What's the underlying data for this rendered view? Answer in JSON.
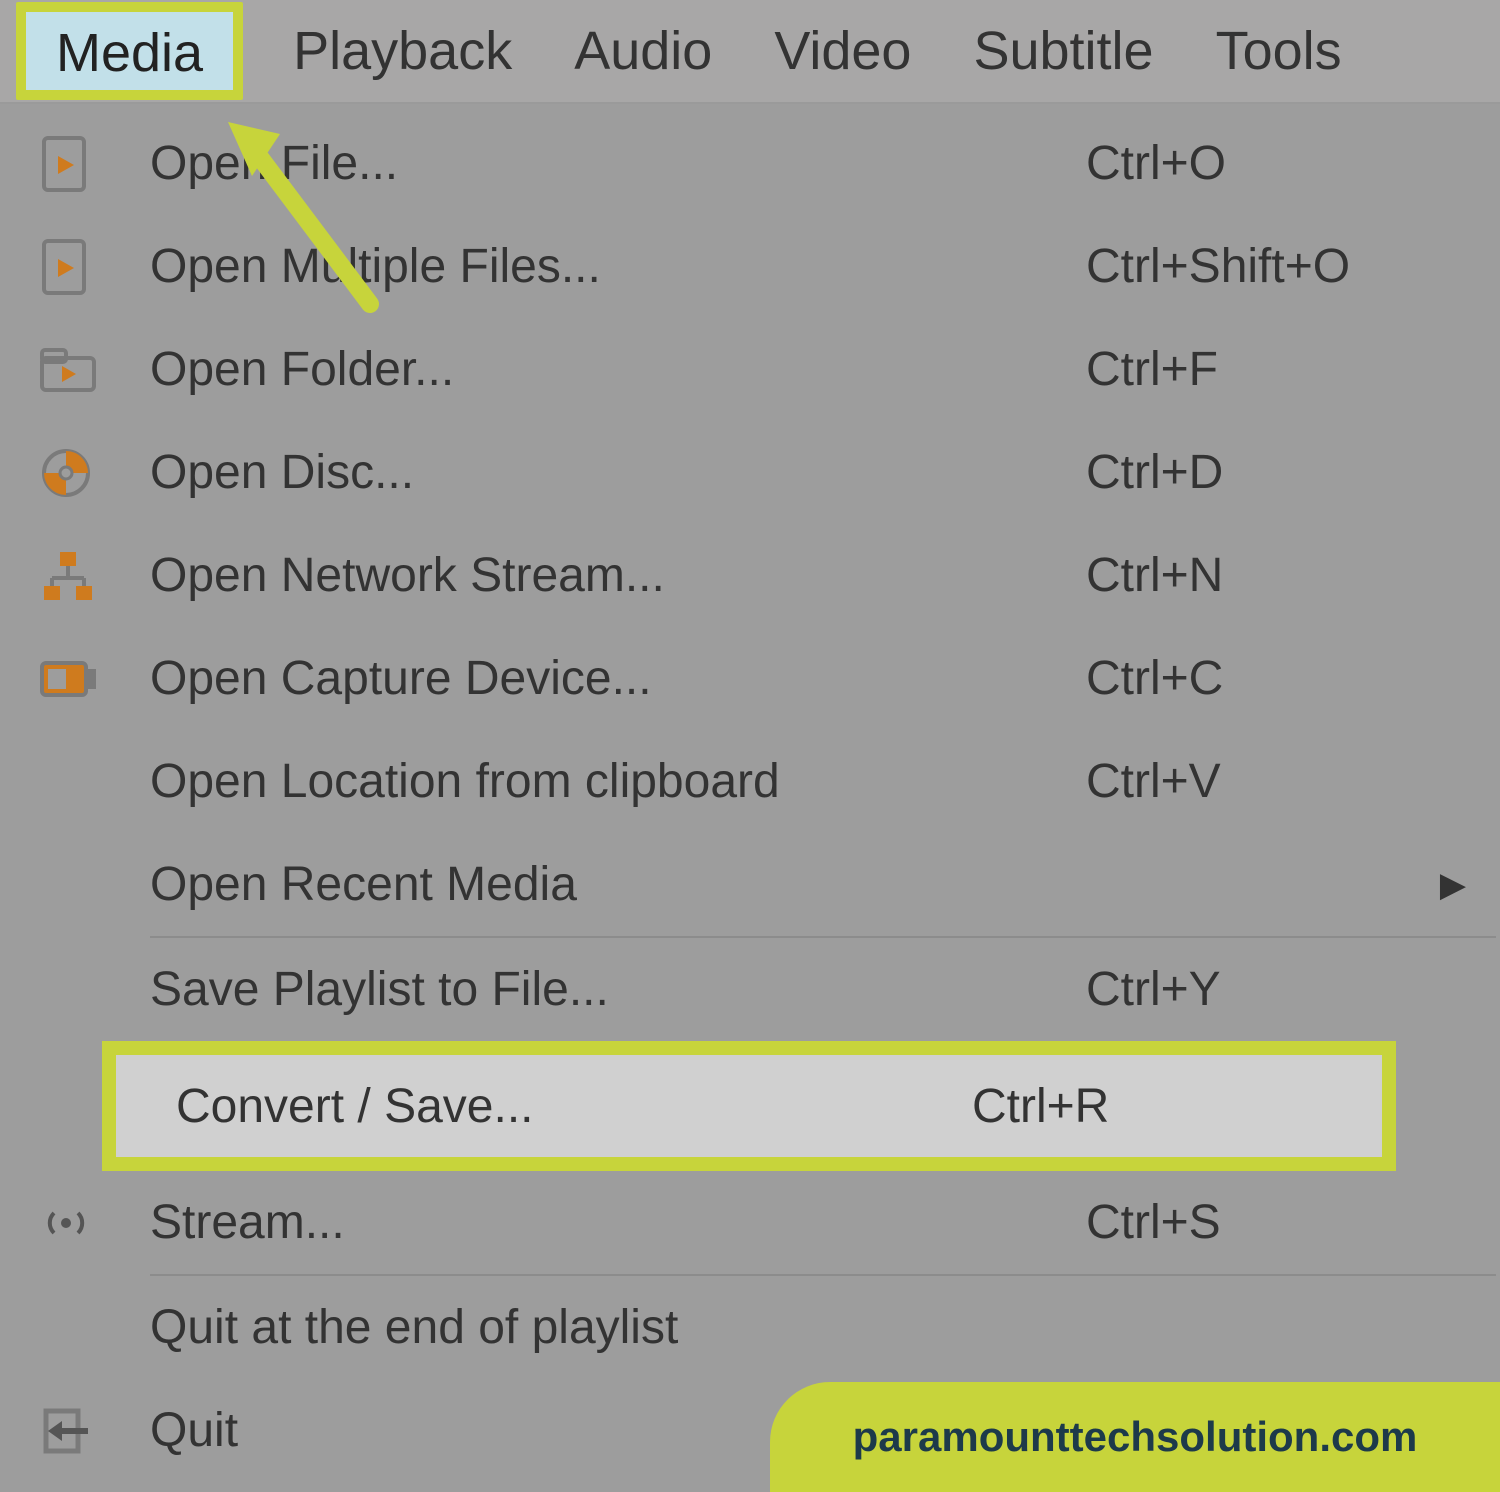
{
  "menubar": {
    "items": [
      {
        "label": "Media",
        "active": true
      },
      {
        "label": "Playback"
      },
      {
        "label": "Audio"
      },
      {
        "label": "Video"
      },
      {
        "label": "Subtitle"
      },
      {
        "label": "Tools"
      }
    ]
  },
  "dropdown": {
    "items": [
      {
        "icon": "file-play-icon",
        "label": "Open File...",
        "shortcut": "Ctrl+O"
      },
      {
        "icon": "file-play-icon",
        "label": "Open Multiple Files...",
        "shortcut": "Ctrl+Shift+O"
      },
      {
        "icon": "folder-play-icon",
        "label": "Open Folder...",
        "shortcut": "Ctrl+F"
      },
      {
        "icon": "disc-icon",
        "label": "Open Disc...",
        "shortcut": "Ctrl+D"
      },
      {
        "icon": "network-icon",
        "label": "Open Network Stream...",
        "shortcut": "Ctrl+N"
      },
      {
        "icon": "capture-device-icon",
        "label": "Open Capture Device...",
        "shortcut": "Ctrl+C"
      },
      {
        "icon": "",
        "label": "Open Location from clipboard",
        "shortcut": "Ctrl+V"
      },
      {
        "icon": "",
        "label": "Open Recent Media",
        "shortcut": "",
        "submenu": true
      },
      {
        "separator": true
      },
      {
        "icon": "",
        "label": "Save Playlist to File...",
        "shortcut": "Ctrl+Y"
      },
      {
        "icon": "",
        "label": "Convert / Save...",
        "shortcut": "Ctrl+R",
        "highlight": true
      },
      {
        "icon": "stream-icon",
        "label": "Stream...",
        "shortcut": "Ctrl+S"
      },
      {
        "separator": true
      },
      {
        "icon": "",
        "label": "Quit at the end of playlist",
        "shortcut": ""
      },
      {
        "icon": "quit-icon",
        "label": "Quit",
        "shortcut": ""
      }
    ]
  },
  "annotations": {
    "watermark": "paramounttechsolution.com"
  },
  "colors": {
    "highlight": "#c7d43b",
    "menubar_bg": "#a8a7a7",
    "row_hover": "#d0d0d0",
    "text": "#333333"
  }
}
